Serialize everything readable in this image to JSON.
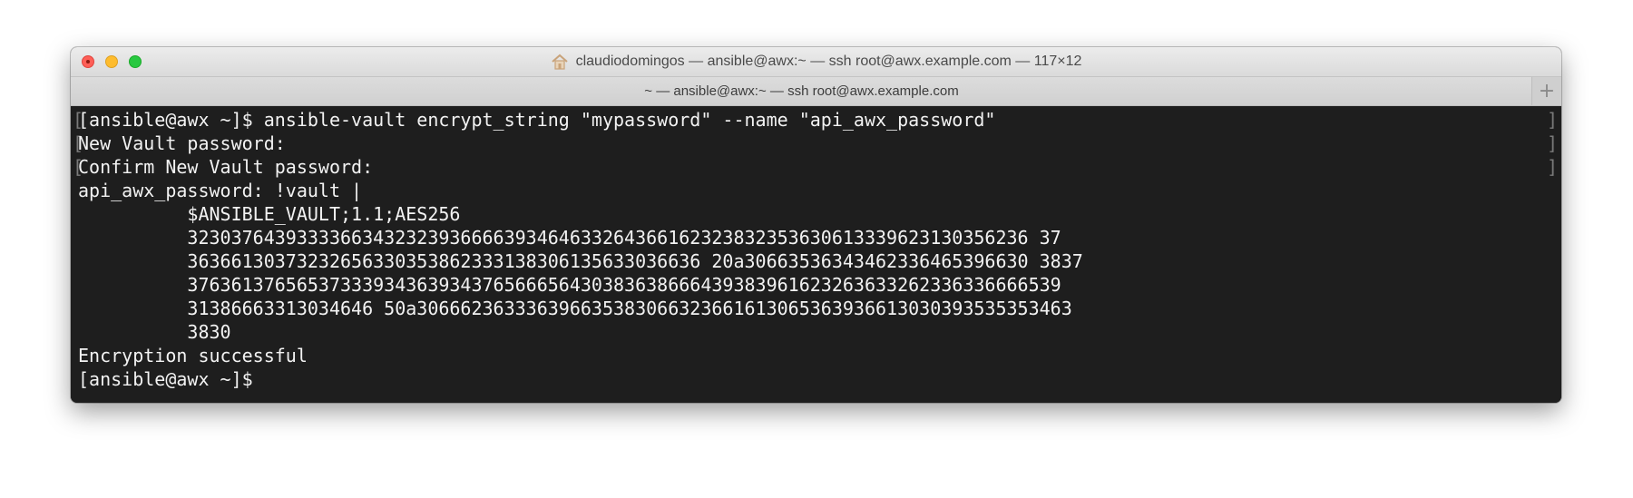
{
  "window": {
    "title": "claudiodomingos — ansible@awx:~ — ssh root@awx.example.com — 117×12"
  },
  "tab": {
    "label": "~ — ansible@awx:~ — ssh root@awx.example.com",
    "new_tab_icon": "plus-icon"
  },
  "terminal": {
    "lines": [
      "[ansible@awx ~]$ ansible-vault encrypt_string \"mypassword\" --name \"api_awx_password\"",
      "New Vault password:",
      "Confirm New Vault password:",
      "api_awx_password: !vault |",
      "          $ANSIBLE_VAULT;1.1;AES256",
      "          32303764393333663432323936666393464633264366162323832353630613339623130356236 37",
      "          36366130373232656330353862333138306135633036636 20a30663536343462336465396630 3837",
      "          37636137656537333934363934376566656430383638666439383961623263633262336336666539",
      "          31386663313034646 50a306662363336396635383066323661613065363936613030393535353463",
      "          3830",
      "Encryption successful",
      "[ansible@awx ~]$"
    ],
    "colors": {
      "background": "#1e1e1e",
      "foreground": "#f2f2f2"
    }
  }
}
